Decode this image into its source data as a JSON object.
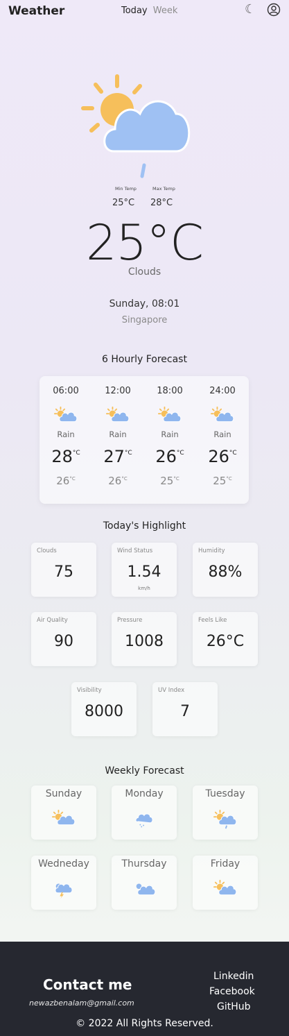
{
  "header": {
    "brand": "Weather",
    "tabs": [
      {
        "label": "Today",
        "active": true
      },
      {
        "label": "Week",
        "active": false
      }
    ],
    "icons": [
      "moon-icon",
      "user-icon"
    ]
  },
  "current": {
    "icon": "sun-cloud-rain-icon",
    "min_label": "Min Temp",
    "max_label": "Max Temp",
    "min_temp": "25°C",
    "max_temp": "28°C",
    "temp": "25°C",
    "condition": "Clouds",
    "datetime": "Sunday, 08:01",
    "city": "Singapore"
  },
  "hourly": {
    "title": "6 Hourly Forecast",
    "unit": "°C",
    "items": [
      {
        "time": "06:00",
        "icon": "partly-cloudy-icon",
        "condition": "Rain",
        "max": "28",
        "min": "26"
      },
      {
        "time": "12:00",
        "icon": "partly-cloudy-icon",
        "condition": "Rain",
        "max": "27",
        "min": "26"
      },
      {
        "time": "18:00",
        "icon": "partly-cloudy-icon",
        "condition": "Rain",
        "max": "26",
        "min": "25"
      },
      {
        "time": "24:00",
        "icon": "partly-cloudy-icon",
        "condition": "Rain",
        "max": "26",
        "min": "25"
      }
    ]
  },
  "highlights": {
    "title": "Today's Highlight",
    "items": [
      {
        "label": "Clouds",
        "value": "75",
        "sub": ""
      },
      {
        "label": "Wind Status",
        "value": "1.54",
        "sub": "km/h"
      },
      {
        "label": "Humidity",
        "value": "88%",
        "sub": ""
      },
      {
        "label": "Air Quality",
        "value": "90",
        "sub": ""
      },
      {
        "label": "Pressure",
        "value": "1008",
        "sub": ""
      },
      {
        "label": "Feels Like",
        "value": "26°C",
        "sub": ""
      },
      {
        "label": "Visibility",
        "value": "8000",
        "sub": ""
      },
      {
        "label": "UV Index",
        "value": "7",
        "sub": ""
      }
    ]
  },
  "weekly": {
    "title": "Weekly Forecast",
    "items": [
      {
        "day": "Sunday",
        "icon": "partly-cloudy-icon"
      },
      {
        "day": "Monday",
        "icon": "cloud-snow-icon"
      },
      {
        "day": "Tuesday",
        "icon": "sun-cloud-rain-icon"
      },
      {
        "day": "Wedneday",
        "icon": "thunderstorm-icon"
      },
      {
        "day": "Thursday",
        "icon": "cloud-icon"
      },
      {
        "day": "Friday",
        "icon": "partly-cloudy-icon"
      }
    ]
  },
  "footer": {
    "contact_title": "Contact me",
    "email": "newazbenalam@gmail.com",
    "links": [
      "Linkedin",
      "Facebook",
      "GitHub"
    ],
    "copyright": "© 2022 All Rights Reserved."
  },
  "colors": {
    "sun": "#f6bf5b",
    "cloud": "#9fc1f3",
    "footer_bg": "#262830"
  }
}
